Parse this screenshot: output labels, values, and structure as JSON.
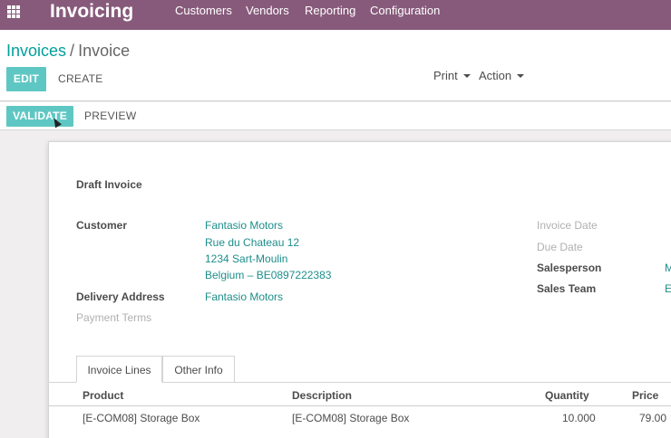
{
  "navbar": {
    "app_title": "Invoicing",
    "menu": [
      "Customers",
      "Vendors",
      "Reporting",
      "Configuration"
    ]
  },
  "breadcrumb": {
    "parent": "Invoices",
    "separator": "/",
    "current": "Invoice"
  },
  "buttons": {
    "edit": "EDIT",
    "create": "CREATE",
    "validate": "VALIDATE",
    "preview": "PREVIEW"
  },
  "toolbar": {
    "print": "Print",
    "action": "Action"
  },
  "invoice": {
    "status": "Draft Invoice",
    "customer_label": "Customer",
    "customer_lines": [
      "Fantasio Motors",
      "Rue du Chateau 12",
      "1234 Sart-Moulin",
      "Belgium – BE0897222383"
    ],
    "delivery_label": "Delivery Address",
    "delivery_value": "Fantasio Motors",
    "payment_terms_label": "Payment Terms",
    "invoice_date_label": "Invoice Date",
    "due_date_label": "Due Date",
    "salesperson_label": "Salesperson",
    "salesperson_value": "M",
    "sales_team_label": "Sales Team",
    "sales_team_value": "E"
  },
  "tabs": [
    "Invoice Lines",
    "Other Info"
  ],
  "lines": {
    "headers": {
      "product": "Product",
      "description": "Description",
      "quantity": "Quantity",
      "price": "Price"
    },
    "rows": [
      {
        "product": "[E-COM08] Storage Box",
        "description": "[E-COM08] Storage Box",
        "quantity": "10.000",
        "price": "79.00"
      }
    ]
  }
}
